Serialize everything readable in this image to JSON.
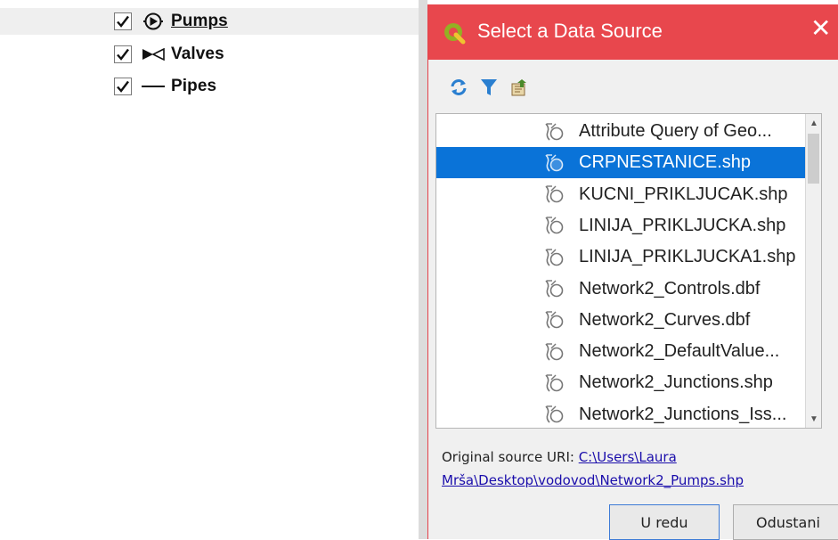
{
  "layer_tree": {
    "items": [
      {
        "label": "Pumps",
        "checked": true,
        "symbol": "pump-icon"
      },
      {
        "label": "Valves",
        "checked": true,
        "symbol": "valve-icon"
      },
      {
        "label": "Pipes",
        "checked": true,
        "symbol": "pipe-line-icon"
      }
    ]
  },
  "dialog": {
    "title": "Select a Data Source",
    "close_glyph": "✕",
    "toolbar": [
      "refresh-icon",
      "filter-icon",
      "import-icon"
    ],
    "list": {
      "items": [
        {
          "label": "Attribute Query of Geo..."
        },
        {
          "label": "CRPNESTANICE.shp",
          "selected": true
        },
        {
          "label": "KUCNI_PRIKLJUCAK.shp"
        },
        {
          "label": "LINIJA_PRIKLJUCKA.shp"
        },
        {
          "label": "LINIJA_PRIKLJUCKA1.shp"
        },
        {
          "label": "Network2_Controls.dbf"
        },
        {
          "label": "Network2_Curves.dbf"
        },
        {
          "label": "Network2_DefaultValue..."
        },
        {
          "label": "Network2_Junctions.shp"
        },
        {
          "label": "Network2_Junctions_Iss..."
        }
      ]
    },
    "uri_label": "Original source URI: ",
    "uri_line1": "C:\\Users\\Laura",
    "uri_line2": "Mrša\\Desktop\\vodovod\\Network2_Pumps.shp",
    "ok_label": "U redu",
    "cancel_label": "Odustani",
    "colors": {
      "titlebar": "#e8474d",
      "selection": "#0a73d8"
    }
  }
}
